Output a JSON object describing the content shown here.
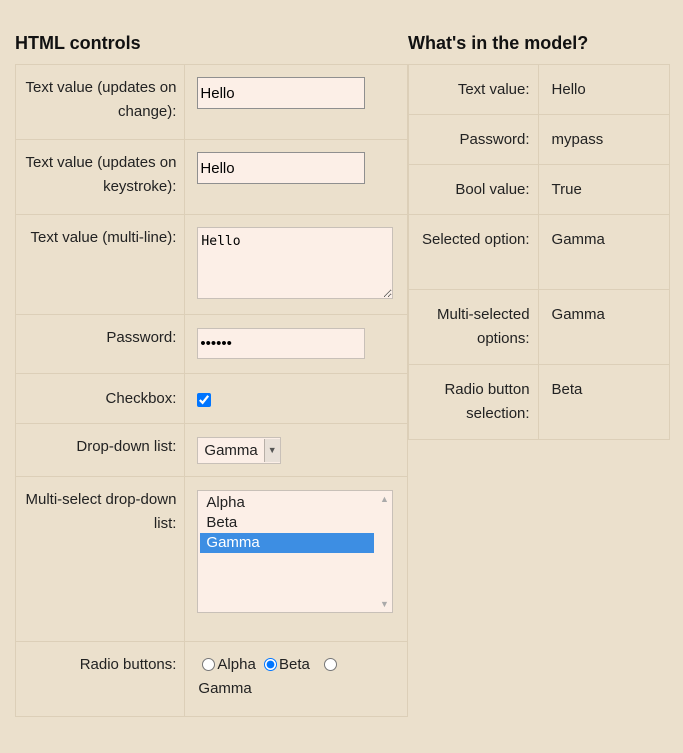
{
  "left": {
    "title": "HTML controls",
    "text_change": {
      "label": "Text value (updates on change):",
      "value": "Hello"
    },
    "text_keystroke": {
      "label": "Text value (updates on keystroke):",
      "value": "Hello"
    },
    "text_multiline": {
      "label": "Text value (multi-line):",
      "value": "Hello"
    },
    "password": {
      "label": "Password:",
      "value": "mypass"
    },
    "checkbox": {
      "label": "Checkbox:",
      "checked": true
    },
    "dropdown": {
      "label": "Drop-down list:",
      "selected": "Gamma",
      "arrow_icon": "chevron-down-icon"
    },
    "multiselect": {
      "label": "Multi-select drop-down list:",
      "options": [
        "Alpha",
        "Beta",
        "Gamma"
      ],
      "selected": "Gamma"
    },
    "radios": {
      "label": "Radio buttons:",
      "options": [
        "Alpha",
        "Beta",
        "Gamma"
      ],
      "selected": "Beta"
    }
  },
  "right": {
    "title": "What's in the model?",
    "rows": [
      {
        "label": "Text value:",
        "value": "Hello"
      },
      {
        "label": "Password:",
        "value": "mypass"
      },
      {
        "label": "Bool value:",
        "value": "True"
      },
      {
        "label": "Selected option:",
        "value": "Gamma"
      },
      {
        "label": "Multi-selected options:",
        "value": "Gamma"
      },
      {
        "label": "Radio button selection:",
        "value": "Beta"
      }
    ]
  },
  "colors": {
    "background": "#ebe0cc",
    "input_background": "#fcefe7",
    "selection": "#3d8ee3",
    "border": "#dccfb8"
  }
}
